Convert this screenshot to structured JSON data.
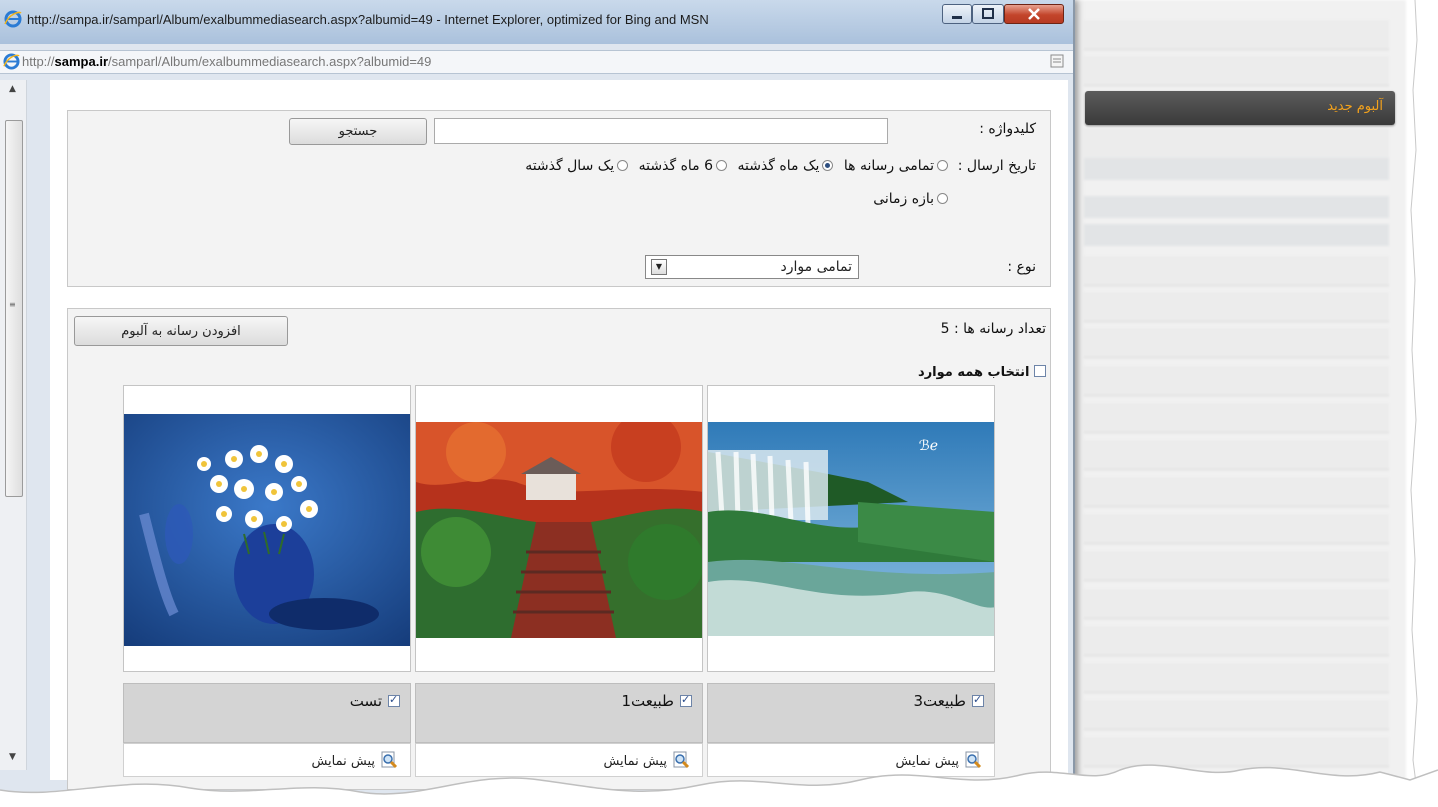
{
  "window": {
    "title": "http://sampa.ir/samparl/Album/exalbummediasearch.aspx?albumid=49 - Internet Explorer, optimized for Bing and MSN",
    "address_domain_prefix": "http://",
    "address_domain": "sampa.ir",
    "address_path": "/samparl/Album/exalbummediasearch.aspx?albumid=49"
  },
  "background_menu": {
    "active_item": "آلبوم جدید"
  },
  "search": {
    "keyword_label": "کلیدواژه :",
    "keyword_value": "",
    "search_button": "جستجو",
    "date_label": "تاریخ ارسال :",
    "date_options": [
      "تمامی رسانه ها",
      "یک ماه گذشته",
      "6 ماه گذشته",
      "یک سال گذشته"
    ],
    "date_option_range": "بازه زمانی",
    "date_selected": "یک ماه گذشته",
    "type_label": "نوع :",
    "type_value": "تمامی موارد"
  },
  "results": {
    "count_text": "تعداد رسانه ها : 5",
    "add_button": "افزودن رسانه به آلبوم",
    "select_all_label": "انتخاب همه موارد",
    "items": [
      {
        "caption": "طبیعت3",
        "checked": true,
        "preview_label": "پیش نمایش",
        "image": "waterfall"
      },
      {
        "caption": "طبیعت1",
        "checked": true,
        "preview_label": "پیش نمایش",
        "image": "autumn-path"
      },
      {
        "caption": "تست",
        "checked": true,
        "preview_label": "پیش نمایش",
        "image": "blue-flowers-vase"
      }
    ]
  }
}
